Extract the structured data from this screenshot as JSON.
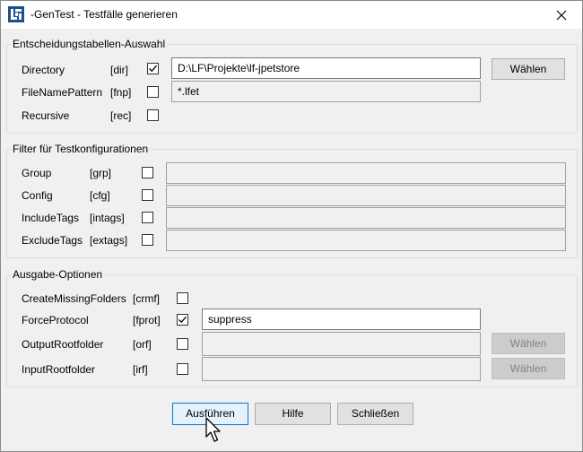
{
  "window": {
    "title": "-GenTest - Testfälle generieren"
  },
  "group_entscheidung": {
    "legend": "Entscheidungstabellen-Auswahl",
    "rows": [
      {
        "label": "Directory",
        "flag": "[dir]",
        "checked": true,
        "value": "D:\\LF\\Projekte\\lf-jpetstore",
        "button": "Wählen"
      },
      {
        "label": "FileNamePattern",
        "flag": "[fnp]",
        "checked": false,
        "value": "*.lfet"
      },
      {
        "label": "Recursive",
        "flag": "[rec]",
        "checked": false
      }
    ]
  },
  "group_filter": {
    "legend": "Filter für Testkonfigurationen",
    "rows": [
      {
        "label": "Group",
        "flag": "[grp]",
        "checked": false,
        "value": ""
      },
      {
        "label": "Config",
        "flag": "[cfg]",
        "checked": false,
        "value": ""
      },
      {
        "label": "IncludeTags",
        "flag": "[intags]",
        "checked": false,
        "value": ""
      },
      {
        "label": "ExcludeTags",
        "flag": "[extags]",
        "checked": false,
        "value": ""
      }
    ]
  },
  "group_ausgabe": {
    "legend": "Ausgabe-Optionen",
    "rows": [
      {
        "label": "CreateMissingFolders",
        "flag": "[crmf]",
        "checked": false
      },
      {
        "label": "ForceProtocol",
        "flag": "[fprot]",
        "checked": true,
        "value": "suppress"
      },
      {
        "label": "OutputRootfolder",
        "flag": "[orf]",
        "checked": false,
        "value": "",
        "button": "Wählen"
      },
      {
        "label": "InputRootfolder",
        "flag": "[irf]",
        "checked": false,
        "value": "",
        "button": "Wählen"
      }
    ]
  },
  "footer": {
    "run_label": "Ausführen",
    "help_label": "Hilfe",
    "close_label": "Schließen"
  },
  "colors": {
    "accent": "#0078d7",
    "disabled_text": "#838383",
    "icon_blue": "#1e4e8c"
  }
}
